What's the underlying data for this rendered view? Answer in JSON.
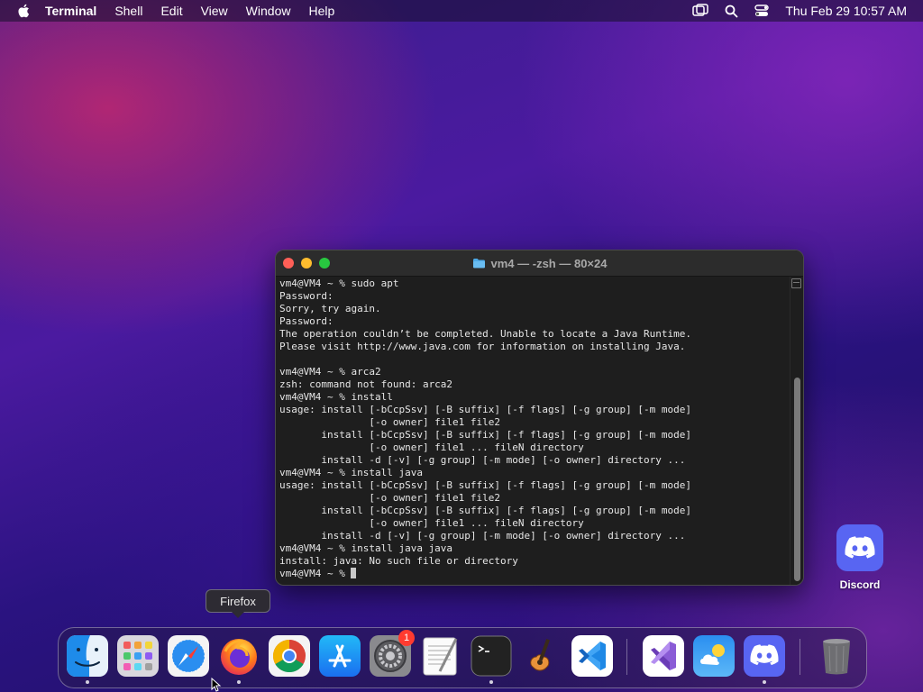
{
  "menubar": {
    "app_name": "Terminal",
    "items": [
      "Shell",
      "Edit",
      "View",
      "Window",
      "Help"
    ],
    "clock": "Thu Feb 29  10:57 AM",
    "icons": [
      "apple-icon",
      "screen-mirroring-icon",
      "search-icon",
      "control-center-icon"
    ]
  },
  "terminal": {
    "title": "vm4 — -zsh — 80×24",
    "lines": [
      "vm4@VM4 ~ % sudo apt",
      "Password:",
      "Sorry, try again.",
      "Password:",
      "The operation couldn’t be completed. Unable to locate a Java Runtime.",
      "Please visit http://www.java.com for information on installing Java.",
      "",
      "vm4@VM4 ~ % arca2",
      "zsh: command not found: arca2",
      "vm4@VM4 ~ % install",
      "usage: install [-bCcpSsv] [-B suffix] [-f flags] [-g group] [-m mode]",
      "               [-o owner] file1 file2",
      "       install [-bCcpSsv] [-B suffix] [-f flags] [-g group] [-m mode]",
      "               [-o owner] file1 ... fileN directory",
      "       install -d [-v] [-g group] [-m mode] [-o owner] directory ...",
      "vm4@VM4 ~ % install java",
      "usage: install [-bCcpSsv] [-B suffix] [-f flags] [-g group] [-m mode]",
      "               [-o owner] file1 file2",
      "       install [-bCcpSsv] [-B suffix] [-f flags] [-g group] [-m mode]",
      "               [-o owner] file1 ... fileN directory",
      "       install -d [-v] [-g group] [-m mode] [-o owner] directory ...",
      "vm4@VM4 ~ % install java java",
      "install: java: No such file or directory",
      "vm4@VM4 ~ % "
    ]
  },
  "desktop": {
    "discord_label": "Discord"
  },
  "tooltip": {
    "text": "Firefox"
  },
  "dock": {
    "items": [
      {
        "name": "Finder",
        "icon": "finder-icon",
        "running": true
      },
      {
        "name": "Launchpad",
        "icon": "launchpad-icon",
        "running": false
      },
      {
        "name": "Safari",
        "icon": "safari-icon",
        "running": false
      },
      {
        "name": "Firefox",
        "icon": "firefox-icon",
        "running": true
      },
      {
        "name": "Google Chrome",
        "icon": "chrome-icon",
        "running": false
      },
      {
        "name": "App Store",
        "icon": "app-store-icon",
        "running": false
      },
      {
        "name": "System Settings",
        "icon": "system-settings-icon",
        "running": false,
        "badge": "1"
      },
      {
        "name": "TextEdit",
        "icon": "textedit-icon",
        "running": false
      },
      {
        "name": "Terminal",
        "icon": "terminal-icon",
        "running": true
      },
      {
        "name": "GarageBand",
        "icon": "garageband-icon",
        "running": false
      },
      {
        "name": "Visual Studio Code",
        "icon": "vscode-icon",
        "running": false
      },
      {
        "name": "Visual Studio",
        "icon": "visual-studio-icon",
        "running": false
      },
      {
        "name": "Weather",
        "icon": "weather-icon",
        "running": false
      },
      {
        "name": "Discord",
        "icon": "discord-icon",
        "running": true
      },
      {
        "name": "Trash",
        "icon": "trash-icon",
        "running": false
      }
    ]
  },
  "colors": {
    "terminal_bg": "#1e1e1e",
    "close": "#fe5f57",
    "minimize": "#febc2e",
    "zoom": "#28c840",
    "discord": "#5865f2"
  }
}
